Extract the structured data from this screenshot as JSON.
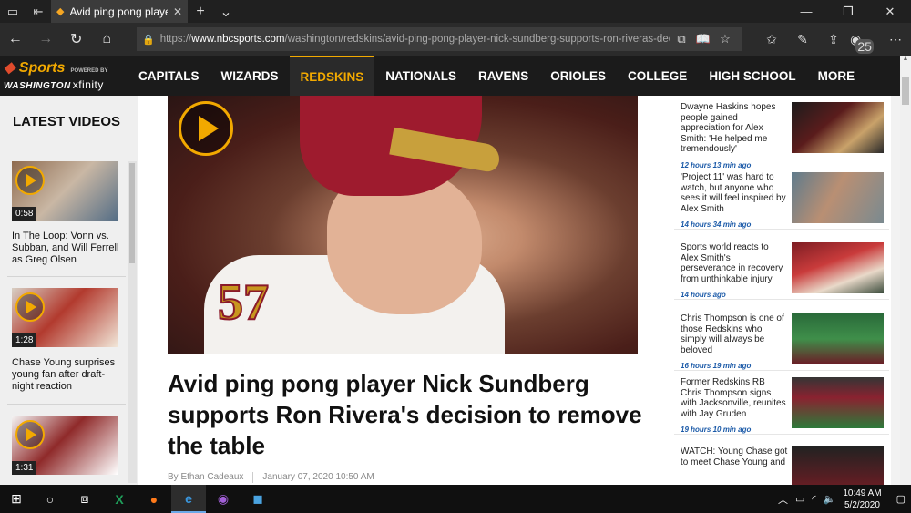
{
  "browser": {
    "tab_title": "Avid ping pong player N",
    "url_scheme": "https://",
    "url_domain": "www.nbcsports.com",
    "url_path": "/washington/redskins/avid-ping-pong-player-nick-sundberg-supports-ron-riveras-decision-rem",
    "badge_count": "25"
  },
  "site": {
    "logo_line1": "Sports",
    "logo_line2": "WASHINGTON",
    "powered_by": "POWERED BY",
    "sponsor": "xfinity",
    "nav": [
      "CAPITALS",
      "WIZARDS",
      "REDSKINS",
      "NATIONALS",
      "RAVENS",
      "ORIOLES",
      "COLLEGE",
      "HIGH SCHOOL",
      "MORE"
    ]
  },
  "sidebar": {
    "heading": "LATEST VIDEOS",
    "videos": [
      {
        "duration": "0:58",
        "title": "In The Loop: Vonn vs. Subban, and Will Ferrell as Greg Olsen"
      },
      {
        "duration": "1:28",
        "title": "Chase Young surprises young fan after draft-night reaction"
      },
      {
        "duration": "1:31",
        "title": ""
      }
    ]
  },
  "article": {
    "headline": "Avid ping pong player Nick Sundberg supports Ron Rivera's decision to remove the table",
    "author": "By Ethan Cadeaux",
    "date": "January 07, 2020 10:50 AM",
    "jersey_number": "57"
  },
  "rail": {
    "stories": [
      {
        "text": "Dwayne Haskins hopes people gained appreciation for Alex Smith: 'He helped me tremendously'",
        "time": "12 hours 13 min ago"
      },
      {
        "text": "'Project 11' was hard to watch, but anyone who sees it will feel inspired by Alex Smith",
        "time": "14 hours 34 min ago"
      },
      {
        "text": "Sports world reacts to Alex Smith's perseverance in recovery from unthinkable injury",
        "time": "14 hours ago"
      },
      {
        "text": "Chris Thompson is one of those Redskins who simply will always be beloved",
        "time": "16 hours 19 min ago"
      },
      {
        "text": "Former Redskins RB Chris Thompson signs with Jacksonville, reunites with Jay Gruden",
        "time": "19 hours 10 min ago"
      },
      {
        "text": "WATCH: Young Chase got to meet Chase Young and",
        "time": ""
      }
    ]
  },
  "taskbar": {
    "time": "10:49 AM",
    "date": "5/2/2020"
  }
}
